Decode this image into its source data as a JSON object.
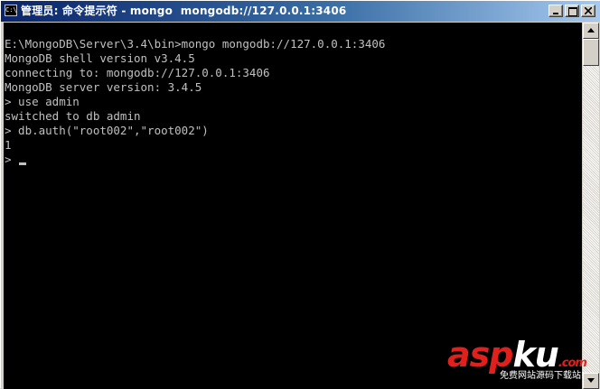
{
  "window": {
    "title": "管理员: 命令提示符 - mongo  mongodb://127.0.0.1:3406",
    "icon": "cmd-app-icon",
    "controls": [
      "minimize-icon",
      "maximize-icon",
      "close-icon"
    ]
  },
  "console": {
    "lines": [
      "",
      "E:\\MongoDB\\Server\\3.4\\bin>mongo mongodb://127.0.0.1:3406",
      "MongoDB shell version v3.4.5",
      "connecting to: mongodb://127.0.0.1:3406",
      "MongoDB server version: 3.4.5",
      "> use admin",
      "switched to db admin",
      "> db.auth(\"root002\",\"root002\")",
      "1",
      "> "
    ],
    "text_color": "#c0c0c0",
    "background": "#000000"
  },
  "watermark": {
    "brand_part1": "asp",
    "brand_part2": "ku",
    "brand_suffix": ".com",
    "tagline": "免费网站源码下载站!"
  }
}
